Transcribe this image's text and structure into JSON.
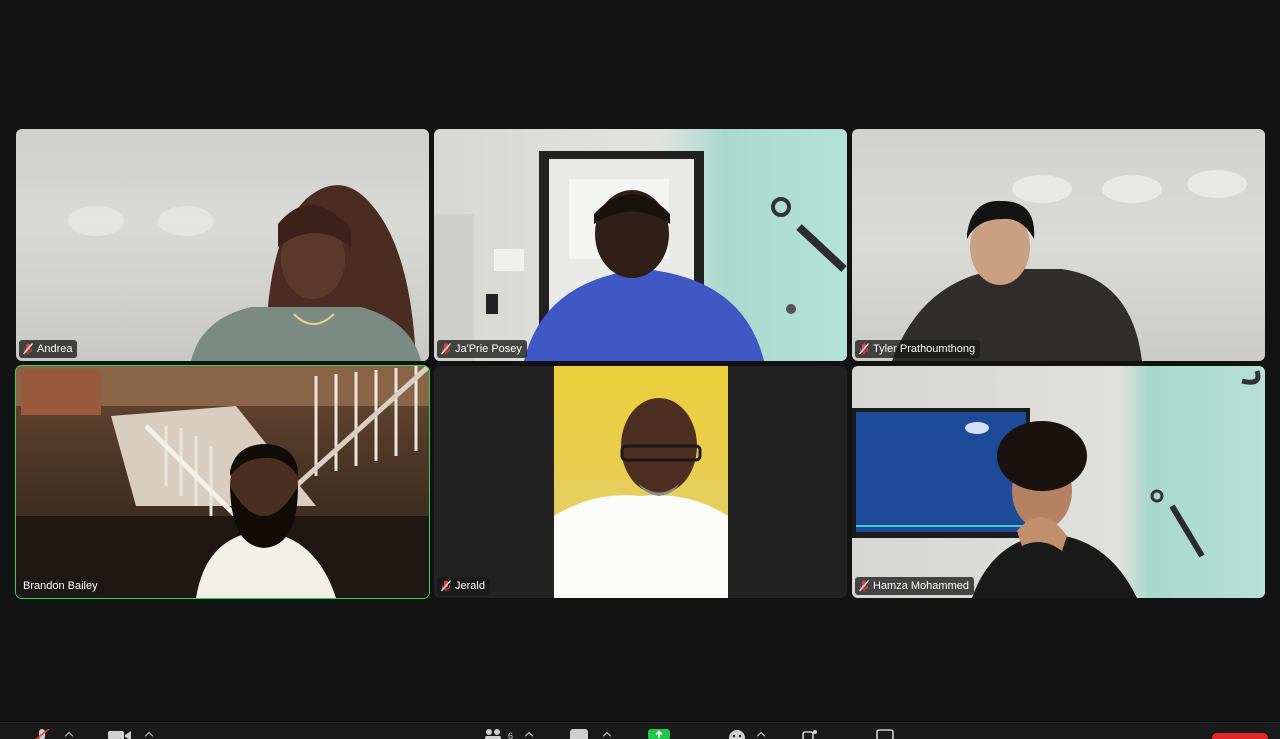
{
  "participants": [
    {
      "name": "Andrea",
      "muted": true,
      "speaking": false
    },
    {
      "name": "Ja'Prie Posey",
      "muted": true,
      "speaking": false
    },
    {
      "name": "Tyler Prathoumthong",
      "muted": true,
      "speaking": false
    },
    {
      "name": "Brandon Bailey",
      "muted": false,
      "speaking": true
    },
    {
      "name": "Jerald",
      "muted": true,
      "speaking": false
    },
    {
      "name": "Hamza Mohammed",
      "muted": true,
      "speaking": false
    }
  ],
  "toolbar": {
    "participants_count": "6",
    "share_color": "#1fc84a",
    "end_color": "#e02828"
  },
  "colors": {
    "active_speaker_border": "#2fd35a",
    "muted_mic": "#e0423a"
  }
}
